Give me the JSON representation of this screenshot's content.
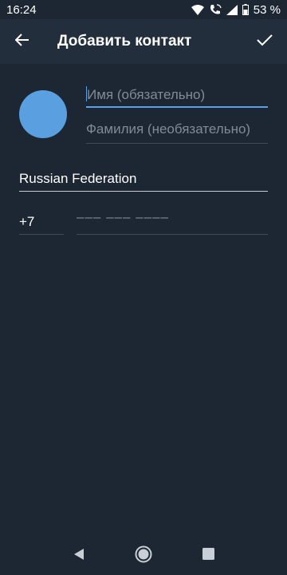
{
  "status_bar": {
    "time": "16:24",
    "battery": "53 %",
    "icons": [
      "wifi-icon",
      "wifi-call-icon",
      "signal-icon",
      "battery-icon"
    ]
  },
  "app_bar": {
    "title": "Добавить контакт",
    "back_icon": "arrow-left-icon",
    "done_icon": "check-icon"
  },
  "form": {
    "first_name_placeholder": "Имя (обязательно)",
    "last_name_placeholder": "Фамилия (необязательно)",
    "country": "Russian Federation",
    "country_code": "+7",
    "phone_placeholder": "––– ––– ––––"
  },
  "colors": {
    "background": "#1d2733",
    "app_bar": "#232e3c",
    "avatar": "#5a9fe0",
    "accent": "#5aa3e8",
    "hint": "#7f8b96"
  },
  "nav_bar": {
    "icons": [
      "back-triangle-icon",
      "home-circle-icon",
      "recents-square-icon"
    ]
  }
}
